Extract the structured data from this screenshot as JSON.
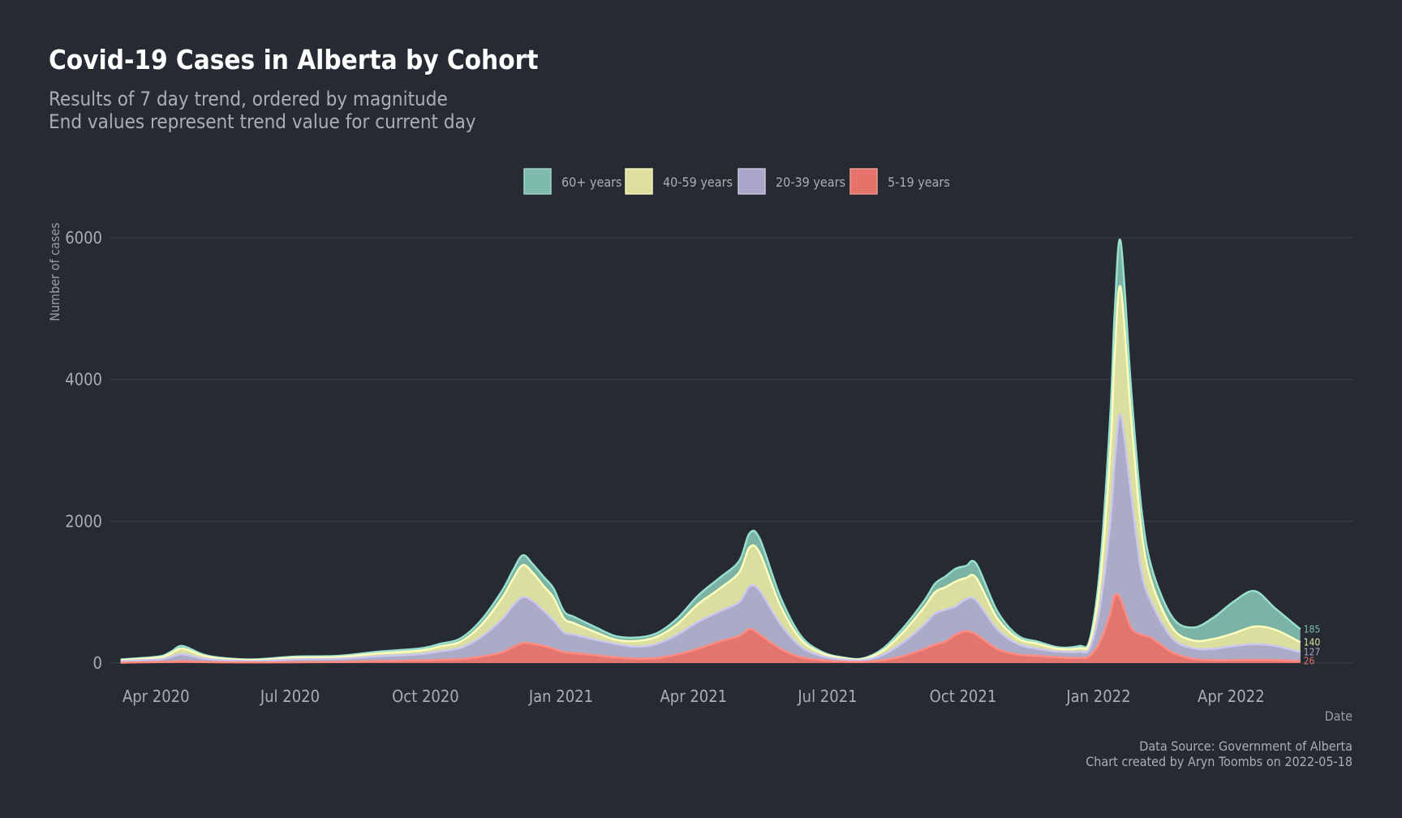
{
  "chart_data": {
    "type": "area",
    "stacked": true,
    "title": "Covid-19 Cases in Alberta by Cohort",
    "subtitle_lines": [
      "Results of 7 day trend, ordered by magnitude",
      "End values represent trend value for current day"
    ],
    "xlabel": "Date",
    "ylabel": "Number of cases",
    "ylim": [
      0,
      6000
    ],
    "y_ticks": [
      0,
      2000,
      4000,
      6000
    ],
    "y_tick_labels": [
      "0",
      "2000",
      "4000",
      "6000"
    ],
    "xlim": [
      "2020-03-01",
      "2022-06-23"
    ],
    "x_ticks": [
      "2020-04-01",
      "2020-07-01",
      "2020-10-01",
      "2021-01-01",
      "2021-04-01",
      "2021-07-01",
      "2021-10-01",
      "2022-01-01",
      "2022-04-01"
    ],
    "x_tick_labels": [
      "Apr 2020",
      "Jul 2020",
      "Oct 2020",
      "Jan 2021",
      "Apr 2021",
      "Jul 2021",
      "Oct 2021",
      "Jan 2022",
      "Apr 2022"
    ],
    "grid": "horizontal",
    "legend_position": "top-center",
    "x": [
      "2020-03-08",
      "2020-03-22",
      "2020-04-05",
      "2020-04-12",
      "2020-04-19",
      "2020-05-03",
      "2020-05-17",
      "2020-06-07",
      "2020-07-05",
      "2020-08-02",
      "2020-08-30",
      "2020-09-27",
      "2020-10-11",
      "2020-10-25",
      "2020-11-08",
      "2020-11-22",
      "2020-11-29",
      "2020-12-06",
      "2020-12-13",
      "2020-12-20",
      "2020-12-27",
      "2021-01-03",
      "2021-01-10",
      "2021-01-24",
      "2021-02-07",
      "2021-02-21",
      "2021-03-07",
      "2021-03-21",
      "2021-04-04",
      "2021-04-18",
      "2021-05-02",
      "2021-05-09",
      "2021-05-16",
      "2021-05-30",
      "2021-06-13",
      "2021-06-27",
      "2021-07-11",
      "2021-07-25",
      "2021-08-08",
      "2021-08-22",
      "2021-09-05",
      "2021-09-12",
      "2021-09-19",
      "2021-09-26",
      "2021-10-03",
      "2021-10-10",
      "2021-10-24",
      "2021-11-07",
      "2021-11-21",
      "2021-12-05",
      "2021-12-19",
      "2021-12-26",
      "2022-01-02",
      "2022-01-09",
      "2022-01-12",
      "2022-01-16",
      "2022-01-23",
      "2022-01-30",
      "2022-02-06",
      "2022-02-20",
      "2022-03-06",
      "2022-03-20",
      "2022-04-03",
      "2022-04-17",
      "2022-05-01",
      "2022-05-18"
    ],
    "series": [
      {
        "name": "5-19 years",
        "color": "#e5736a",
        "end_value": 26,
        "values": [
          5,
          10,
          15,
          20,
          25,
          15,
          10,
          8,
          12,
          15,
          25,
          35,
          45,
          55,
          90,
          150,
          220,
          280,
          270,
          240,
          200,
          150,
          140,
          110,
          80,
          60,
          70,
          120,
          200,
          300,
          380,
          480,
          400,
          200,
          80,
          40,
          20,
          15,
          40,
          100,
          200,
          260,
          300,
          400,
          450,
          400,
          200,
          120,
          100,
          80,
          70,
          100,
          300,
          700,
          950,
          900,
          500,
          400,
          350,
          150,
          60,
          40,
          40,
          45,
          40,
          26
        ]
      },
      {
        "name": "20-39 years",
        "color": "#a9a6c9",
        "end_value": 127,
        "values": [
          20,
          30,
          40,
          70,
          100,
          50,
          30,
          20,
          40,
          45,
          70,
          90,
          120,
          160,
          280,
          470,
          580,
          650,
          600,
          500,
          400,
          280,
          260,
          220,
          190,
          170,
          200,
          280,
          380,
          420,
          480,
          600,
          620,
          350,
          150,
          60,
          30,
          25,
          80,
          200,
          350,
          440,
          450,
          400,
          450,
          480,
          280,
          150,
          100,
          80,
          90,
          110,
          500,
          1300,
          1900,
          2600,
          1900,
          900,
          500,
          200,
          150,
          160,
          200,
          220,
          200,
          127
        ]
      },
      {
        "name": "40-59 years",
        "color": "#dfe09e",
        "end_value": 140,
        "values": [
          15,
          20,
          30,
          55,
          80,
          40,
          20,
          15,
          25,
          25,
          40,
          50,
          70,
          90,
          170,
          300,
          370,
          450,
          400,
          350,
          320,
          200,
          160,
          110,
          60,
          80,
          100,
          150,
          250,
          320,
          420,
          550,
          530,
          260,
          100,
          40,
          20,
          15,
          60,
          150,
          250,
          300,
          320,
          350,
          300,
          320,
          160,
          80,
          70,
          40,
          50,
          80,
          350,
          1000,
          1500,
          1800,
          1100,
          600,
          300,
          150,
          110,
          140,
          180,
          250,
          230,
          140
        ]
      },
      {
        "name": "60+ years",
        "color": "#7fbbab",
        "end_value": 185,
        "values": [
          10,
          10,
          15,
          25,
          35,
          15,
          10,
          8,
          15,
          15,
          25,
          30,
          35,
          45,
          70,
          100,
          120,
          140,
          120,
          130,
          130,
          100,
          90,
          70,
          50,
          50,
          50,
          80,
          120,
          150,
          160,
          200,
          200,
          120,
          50,
          20,
          10,
          10,
          30,
          60,
          90,
          120,
          150,
          180,
          170,
          200,
          100,
          40,
          30,
          20,
          30,
          40,
          200,
          500,
          600,
          650,
          400,
          300,
          200,
          150,
          180,
          300,
          450,
          500,
          300,
          185
        ]
      }
    ]
  },
  "legend": {
    "items": [
      {
        "label": "60+ years",
        "color": "#7fbbab"
      },
      {
        "label": "40-59 years",
        "color": "#dfe09e"
      },
      {
        "label": "20-39 years",
        "color": "#a9a6c9"
      },
      {
        "label": "5-19 years",
        "color": "#e5736a"
      }
    ]
  },
  "caption": {
    "source": "Data Source: Government of Alberta",
    "created": "Chart created by Aryn Toombs on 2022-05-18"
  },
  "colors": {
    "background": "#262a32",
    "grid": "#3b404a",
    "text": "#a9adb5",
    "title": "#ffffff"
  }
}
